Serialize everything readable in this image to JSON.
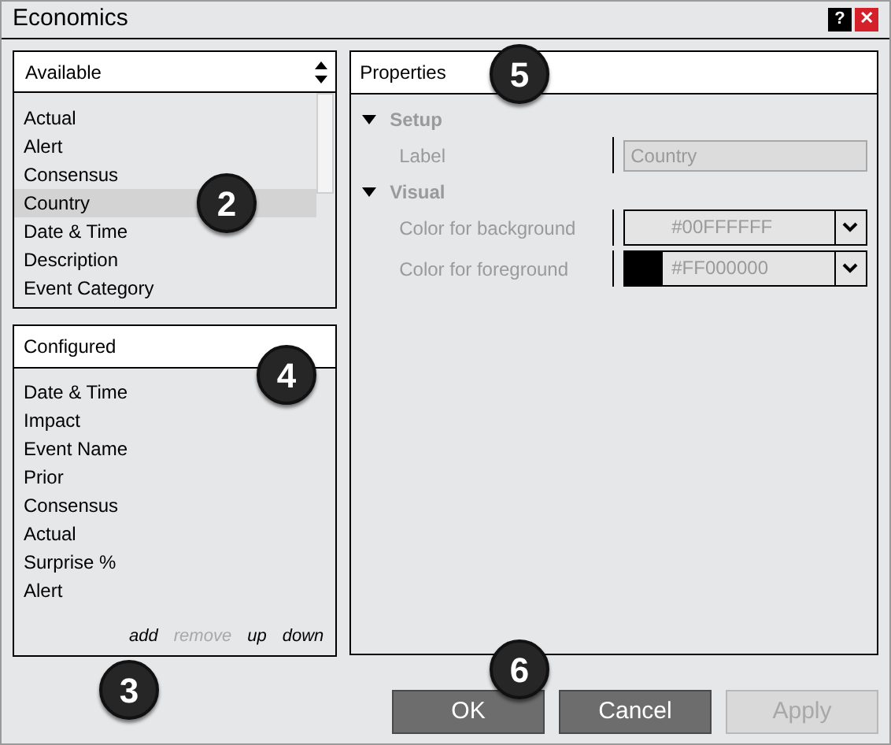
{
  "window": {
    "title": "Economics",
    "buttons": [
      "?",
      "✕"
    ]
  },
  "available": {
    "title": "Available",
    "items": [
      {
        "label": "Actual",
        "selected": false
      },
      {
        "label": "Alert",
        "selected": false
      },
      {
        "label": "Consensus",
        "selected": false
      },
      {
        "label": "Country",
        "selected": true
      },
      {
        "label": "Date & Time",
        "selected": false
      },
      {
        "label": "Description",
        "selected": false
      },
      {
        "label": "Event Category",
        "selected": false
      }
    ]
  },
  "configured": {
    "title": "Configured",
    "items": [
      "Date & Time",
      "Impact",
      "Event Name",
      "Prior",
      "Consensus",
      "Actual",
      "Surprise %",
      "Alert"
    ],
    "actions": [
      {
        "label": "add",
        "disabled": false
      },
      {
        "label": "remove",
        "disabled": true
      },
      {
        "label": "up",
        "disabled": false
      },
      {
        "label": "down",
        "disabled": false
      }
    ]
  },
  "properties": {
    "title": "Properties",
    "sections": [
      {
        "title": "Setup",
        "expanded": true,
        "rows": [
          {
            "kind": "text",
            "label": "Label",
            "value": "Country"
          }
        ]
      },
      {
        "title": "Visual",
        "expanded": true,
        "rows": [
          {
            "kind": "color",
            "label": "Color for background",
            "value": "#00FFFFFF"
          },
          {
            "kind": "color",
            "label": "Color for foreground",
            "value": "#FF000000",
            "color": "#000000"
          }
        ]
      }
    ]
  },
  "buttons": [
    {
      "label": "OK",
      "disabled": false
    },
    {
      "label": "Cancel",
      "disabled": false
    },
    {
      "label": "Apply",
      "disabled": true
    }
  ],
  "callouts": [
    "2",
    "3",
    "4",
    "5",
    "6"
  ]
}
